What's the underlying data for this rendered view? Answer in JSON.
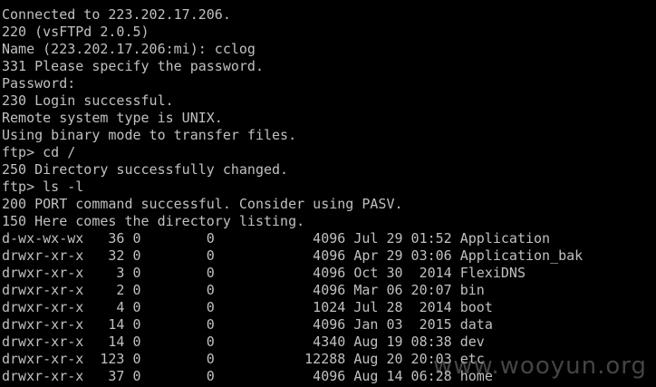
{
  "terminal": {
    "text_color": "#c0c0c0",
    "background": "#000000",
    "lines": [
      "",
      "Connected to 223.202.17.206.",
      "220 (vsFTPd 2.0.5)",
      "Name (223.202.17.206:mi): cclog",
      "331 Please specify the password.",
      "Password:",
      "230 Login successful.",
      "Remote system type is UNIX.",
      "Using binary mode to transfer files.",
      "ftp> cd /",
      "250 Directory successfully changed.",
      "ftp> ls -l",
      "200 PORT command successful. Consider using PASV.",
      "150 Here comes the directory listing.",
      "d-wx-wx-wx   36 0        0            4096 Jul 29 01:52 Application",
      "drwxr-xr-x   32 0        0            4096 Apr 29 03:06 Application_bak",
      "drwxr-xr-x    3 0        0            4096 Oct 30  2014 FlexiDNS",
      "drwxr-xr-x    2 0        0            4096 Mar 06 20:07 bin",
      "drwxr-xr-x    4 0        0            1024 Jul 28  2014 boot",
      "drwxr-xr-x   14 0        0            4096 Jan 03  2015 data",
      "drwxr-xr-x   14 0        0            4340 Aug 19 08:38 dev",
      "drwxr-xr-x  123 0        0           12288 Aug 20 20:03 etc",
      "drwxr-xr-x   37 0        0            4096 Aug 14 06:28 home",
      ""
    ]
  },
  "watermark": {
    "text": "www.wooyun.org"
  }
}
